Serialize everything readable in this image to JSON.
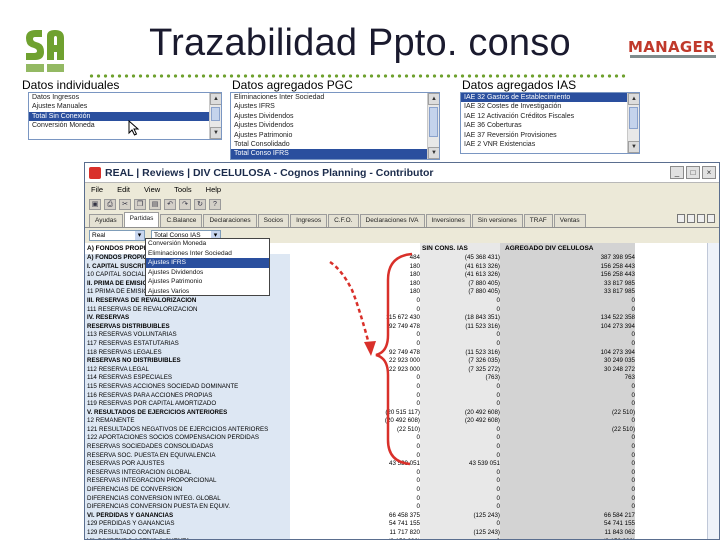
{
  "slide": {
    "title": "Trazabilidad Ppto. conso",
    "brand": "MANAGER",
    "colors": {
      "dots": "#6fa12f",
      "brand": "#c0392b",
      "selection": "#2a4f9e",
      "annotation": "#d9302a"
    }
  },
  "sections": {
    "individual": "Datos individuales",
    "pgc": "Datos agregados PGC",
    "ias": "Datos agregados IAS"
  },
  "list_individual": [
    "Datos Ingresos",
    "Ajustes Manuales",
    "Total Sin Conexión",
    "Conversión Moneda"
  ],
  "list_pgc": [
    "Eliminaciones Inter Sociedad",
    "Ajustes IFRS",
    "Ajustes Dividendos",
    "Ajustes Dividendos",
    "Ajustes Patrimonio",
    "Total Consolidado",
    "Total Conso IFRS"
  ],
  "list_ias": [
    "IAE 32 Gastos de Establecimiento",
    "IAE 32 Costes de Investigación",
    "IAE 12 Activación Créditos Fiscales",
    "IAE 36 Coberturas",
    "IAE 37 Reversión Provisiones",
    "IAE 2 VNR Existencias"
  ],
  "app": {
    "title": "REAL | Reviews | DIV CELULOSA - Cognos Planning - Contributor",
    "menu": [
      "File",
      "Edit",
      "View",
      "Tools",
      "Help"
    ],
    "tabs": [
      "Ayudas",
      "Partidas",
      "C.Balance",
      "Declaraciones",
      "Socios",
      "Ingresos",
      "C.F.O.",
      "Declaraciones IVA",
      "Inversiones",
      "Sin versiones",
      "TRAF",
      "Ventas"
    ],
    "filters": [
      "Real",
      "Total Conso IAS"
    ],
    "grid_headers": {
      "label": "A) FONDOS PROPIOS",
      "col_b": "SIN CONS. IAS",
      "col_c": "AGREGADO DIV CELULOSA"
    },
    "popup_items": [
      "Conversión Moneda",
      "Eliminaciones Inter Sociedad",
      "Ajustes IFRS",
      "Ajustes Dividendos",
      "Ajustes Patrimonio",
      "Ajustes Varios"
    ],
    "rows": [
      [
        "A) FONDOS PROPIOS",
        "484",
        "(45 368 431)",
        "387 398 954"
      ],
      [
        "I. CAPITAL SUSCRITO",
        "180",
        "(41 613 326)",
        "156 258 443"
      ],
      [
        "10 CAPITAL SOCIAL",
        "180",
        "(41 613 326)",
        "156 258 443"
      ],
      [
        "II. PRIMA DE EMISIÓN DE ACCIONES",
        "180",
        "(7 880 405)",
        "33 817 985"
      ],
      [
        "11 PRIMA DE EMISIÓN DE ACCIONES",
        "180",
        "(7 880 405)",
        "33 817 985"
      ],
      [
        "III. RESERVAS DE REVALORIZACIÓN",
        "0",
        "0",
        "0"
      ],
      [
        "111 RESERVAS DE REVALORIZACIÓN",
        "0",
        "0",
        "0"
      ],
      [
        "IV. RESERVAS",
        "115 672 430",
        "(18 843 351)",
        "134 522 358"
      ],
      [
        "RESERVAS DISTRIBUIBLES",
        "92 749 478",
        "(11 523 316)",
        "104 273 394"
      ],
      [
        "113 RESERVAS VOLUNTARIAS",
        "0",
        "0",
        "0"
      ],
      [
        "117 RESERVAS ESTATUTARIAS",
        "0",
        "0",
        "0"
      ],
      [
        "118 RESERVAS LEGALES",
        "92 749 478",
        "(11 523 316)",
        "104 273 394"
      ],
      [
        "RESERVAS NO DISTRIBUIBLES",
        "22 923 000",
        "(7 326 035)",
        "30 249 035"
      ],
      [
        "112 RESERVA LEGAL",
        "22 923 000",
        "(7 325 272)",
        "30 248 272"
      ],
      [
        "114 RESERVAS ESPECIALES",
        "0",
        "(763)",
        "763"
      ],
      [
        "115 RESERVAS ACCIONES SOCIEDAD DOMINANTE",
        "0",
        "0",
        "0"
      ],
      [
        "116 RESERVAS PARA ACCIONES PROPIAS",
        "0",
        "0",
        "0"
      ],
      [
        "119 RESERVAS POR CAPITAL AMORTIZADO",
        "0",
        "0",
        "0"
      ],
      [
        "V. RESULTADOS DE EJERCICIOS ANTERIORES",
        "(20 515 117)",
        "(20 492 608)",
        "(22 510)"
      ],
      [
        "12 REMANENTE",
        "(20 492 608)",
        "(20 492 608)",
        "0"
      ],
      [
        "121 RESULTADOS NEGATIVOS DE EJERCICIOS ANTERIORES",
        "(22 510)",
        "0",
        "(22 510)"
      ],
      [
        "122 APORTACIONES SOCIOS COMPENSACIÓN PÉRDIDAS",
        "0",
        "0",
        "0"
      ],
      [
        "RESERVAS SOCIEDADES CONSOLIDADAS",
        "0",
        "0",
        "0"
      ],
      [
        "RESERVA SOC. PUESTA EN EQUIVALENCIA",
        "0",
        "0",
        "0"
      ],
      [
        "RESERVAS POR AJUSTES",
        "43 539 051",
        "43 539 051",
        "0"
      ],
      [
        "RESERVAS INTEGRACIÓN GLOBAL",
        "0",
        "0",
        "0"
      ],
      [
        "RESERVAS INTEGRACIÓN PROPORCIONAL",
        "0",
        "0",
        "0"
      ],
      [
        "DIFERENCIAS DE CONVERSIÓN",
        "0",
        "0",
        "0"
      ],
      [
        "DIFERENCIAS CONVERSIÓN INTEG. GLOBAL",
        "0",
        "0",
        "0"
      ],
      [
        "DIFERENCIAS CONVERSIÓN PUESTA EN EQUIV.",
        "0",
        "0",
        "0"
      ],
      [
        "VI. PÉRDIDAS Y GANANCIAS",
        "66 458 375",
        "(125 243)",
        "66 584 217"
      ],
      [
        "129 PÉRDIDAS Y GANANCIAS",
        "54 741 155",
        "0",
        "54 741 155"
      ],
      [
        "129 RESULTADO CONTABLE",
        "11 717 820",
        "(125 243)",
        "11 843 062"
      ],
      [
        "VII. DIVIDENDO ACTIVO A CUENTA",
        "(9 159 290)",
        "0",
        "(9 159 290)"
      ],
      [
        "557 DIVIDENDO ACTIVO A CUENTA",
        "(9 159 290)",
        "0",
        "(9 159 290)"
      ]
    ]
  }
}
